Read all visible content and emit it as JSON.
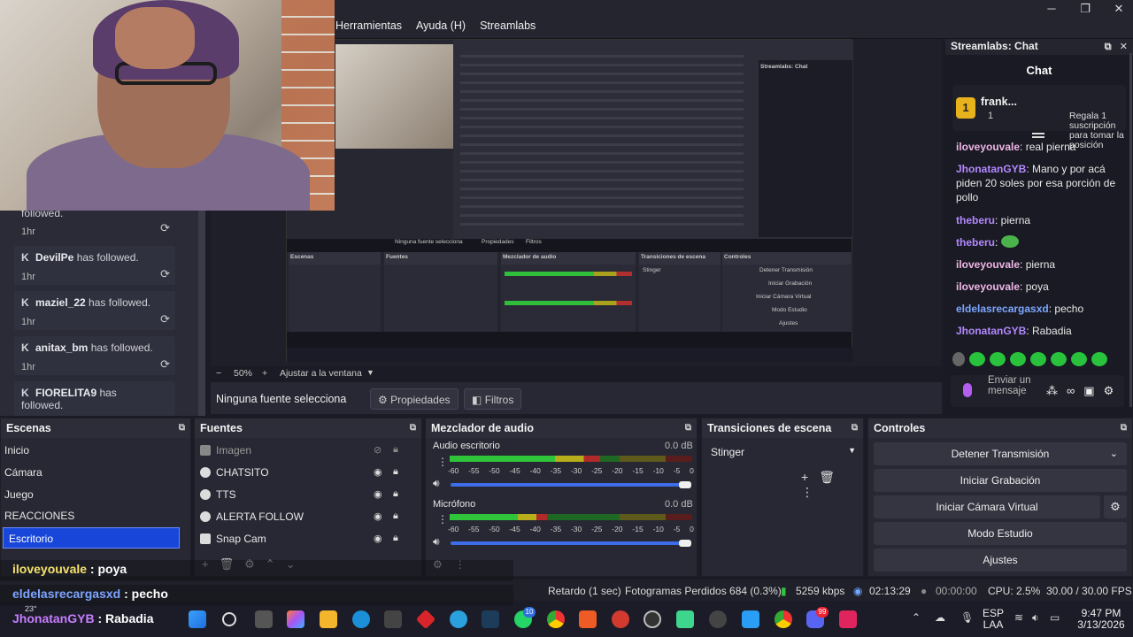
{
  "menu": [
    "Herramientas",
    "Ayuda (H)",
    "Streamlabs"
  ],
  "followers": [
    {
      "name": "",
      "text": "followed.",
      "time": "1hr"
    },
    {
      "name": "DevilPe",
      "text": " has followed.",
      "time": "1hr"
    },
    {
      "name": "maziel_22",
      "text": " has followed.",
      "time": "1hr"
    },
    {
      "name": "anitax_bm",
      "text": " has followed.",
      "time": "1hr"
    },
    {
      "name": "FIORELITA9",
      "text": " has followed.",
      "time": ""
    }
  ],
  "preview": {
    "zoom": "50%",
    "fit": "Ajustar a la ventana",
    "nested_texts": {
      "no_source": "Ninguna fuente selecciona",
      "props": "Propiedades",
      "filters": "Filtros",
      "scenes": "Escenas",
      "sources": "Fuentes",
      "mixer": "Mezclador de audio",
      "transitions": "Transiciones de escena",
      "controls": "Controles",
      "stinger": "Stinger",
      "stop": "Detener Transmisión",
      "rec": "Iniciar Grabación",
      "vcam": "Iniciar Cámara Virtual",
      "studio": "Modo Estudio",
      "settings": "Ajustes",
      "chat_title": "Streamlabs: Chat"
    }
  },
  "context": {
    "no_source": "Ninguna fuente selecciona",
    "properties": "Propiedades",
    "filters": "Filtros"
  },
  "chat": {
    "window_title": "Streamlabs: Chat",
    "title": "Chat",
    "pinned": {
      "name": "frank...",
      "count": "1",
      "desc": "Regala 1 suscripción para tomar la posición"
    },
    "messages": [
      {
        "user": "iloveyouvale",
        "text": ": real pierna",
        "color": "pink"
      },
      {
        "user": "JhonatanGYB",
        "text": ": Mano y por acá piden 20 soles por esa porción de pollo",
        "color": "purple"
      },
      {
        "user": "theberu",
        "text": ": pierna",
        "color": "purple"
      },
      {
        "user": "theberu",
        "text": ":",
        "color": "purple"
      },
      {
        "user": "iloveyouvale",
        "text": ": pierna",
        "color": "pink"
      },
      {
        "user": "iloveyouvale",
        "text": ": poya",
        "color": "pink"
      },
      {
        "user": "eldelasrecargasxd",
        "text": ": pecho",
        "color": "blue"
      },
      {
        "user": "JhonatanGYB",
        "text": ": Rabadia",
        "color": "purple"
      }
    ],
    "input_placeholder": "Enviar un mensaje"
  },
  "scenes": {
    "title": "Escenas",
    "items": [
      "Inicio",
      "Cámara",
      "Juego",
      "REACCIONES",
      "Escritorio"
    ],
    "selected": "Escritorio"
  },
  "sources": {
    "title": "Fuentes",
    "items": [
      "Imagen",
      "CHATSITO",
      "TTS",
      "ALERTA FOLLOW",
      "Snap Cam"
    ]
  },
  "mixer": {
    "title": "Mezclador de audio",
    "channels": [
      {
        "name": "Audio escritorio",
        "db": "0.0 dB",
        "level": 0.62
      },
      {
        "name": "Micrófono",
        "db": "0.0 dB",
        "level": 0.4
      }
    ],
    "ticks": [
      "-60",
      "-55",
      "-50",
      "-45",
      "-40",
      "-35",
      "-30",
      "-25",
      "-20",
      "-15",
      "-10",
      "-5",
      "0"
    ]
  },
  "transitions": {
    "title": "Transiciones de escena",
    "selected": "Stinger"
  },
  "controls": {
    "title": "Controles",
    "buttons": [
      "Detener Transmisión",
      "Iniciar Grabación",
      "Iniciar Cámara Virtual",
      "Modo Estudio",
      "Ajustes"
    ]
  },
  "overlay_chat": [
    {
      "user": "iloveyouvale",
      "text": " : poya"
    },
    {
      "user": "eldelasrecargasxd",
      "text": " : pecho"
    },
    {
      "user": "JhonatanGYB",
      "text": " : Rabadia"
    }
  ],
  "stats": {
    "delay": "Retardo (1 sec)",
    "dropped": "Fotogramas Perdidos 684 (0.3%)",
    "bitrate": "5259 kbps",
    "stream_time": "02:13:29",
    "rec_time": "00:00:00",
    "cpu": "CPU: 2.5%",
    "fps": "30.00 / 30.00 FPS"
  },
  "taskbar": {
    "temp": "23°",
    "lang": "ESP",
    "layout": "LAA",
    "time": "9:47 PM",
    "date": "3/13/2026",
    "whatsapp_badge": "10",
    "discord_badge": "99"
  },
  "colors": {
    "accent": "#1846d8",
    "meter_green": "#30c43b",
    "meter_yellow": "#b8ae1b",
    "meter_red": "#b12a2a"
  }
}
